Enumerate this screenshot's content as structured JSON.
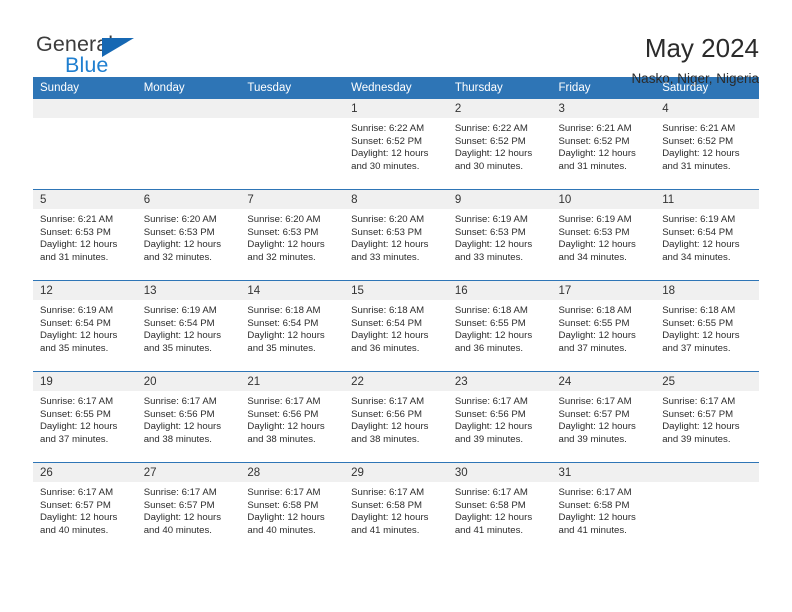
{
  "brand": {
    "word_one": "General",
    "word_two": "Blue",
    "logo_icon": "triangle-flag-icon",
    "accent_color": "#1668b3"
  },
  "header": {
    "title": "May 2024",
    "location": "Nasko, Niger, Nigeria"
  },
  "theme": {
    "header_blue": "#2e75b6",
    "daynum_band": "#f0f0f0",
    "text": "#2c2c2c"
  },
  "weekday_headers": [
    "Sunday",
    "Monday",
    "Tuesday",
    "Wednesday",
    "Thursday",
    "Friday",
    "Saturday"
  ],
  "weeks": [
    [
      {
        "day": "",
        "empty": true
      },
      {
        "day": "",
        "empty": true
      },
      {
        "day": "",
        "empty": true
      },
      {
        "day": "1",
        "sunrise": "Sunrise: 6:22 AM",
        "sunset": "Sunset: 6:52 PM",
        "daylight_1": "Daylight: 12 hours",
        "daylight_2": "and 30 minutes."
      },
      {
        "day": "2",
        "sunrise": "Sunrise: 6:22 AM",
        "sunset": "Sunset: 6:52 PM",
        "daylight_1": "Daylight: 12 hours",
        "daylight_2": "and 30 minutes."
      },
      {
        "day": "3",
        "sunrise": "Sunrise: 6:21 AM",
        "sunset": "Sunset: 6:52 PM",
        "daylight_1": "Daylight: 12 hours",
        "daylight_2": "and 31 minutes."
      },
      {
        "day": "4",
        "sunrise": "Sunrise: 6:21 AM",
        "sunset": "Sunset: 6:52 PM",
        "daylight_1": "Daylight: 12 hours",
        "daylight_2": "and 31 minutes."
      }
    ],
    [
      {
        "day": "5",
        "sunrise": "Sunrise: 6:21 AM",
        "sunset": "Sunset: 6:53 PM",
        "daylight_1": "Daylight: 12 hours",
        "daylight_2": "and 31 minutes."
      },
      {
        "day": "6",
        "sunrise": "Sunrise: 6:20 AM",
        "sunset": "Sunset: 6:53 PM",
        "daylight_1": "Daylight: 12 hours",
        "daylight_2": "and 32 minutes."
      },
      {
        "day": "7",
        "sunrise": "Sunrise: 6:20 AM",
        "sunset": "Sunset: 6:53 PM",
        "daylight_1": "Daylight: 12 hours",
        "daylight_2": "and 32 minutes."
      },
      {
        "day": "8",
        "sunrise": "Sunrise: 6:20 AM",
        "sunset": "Sunset: 6:53 PM",
        "daylight_1": "Daylight: 12 hours",
        "daylight_2": "and 33 minutes."
      },
      {
        "day": "9",
        "sunrise": "Sunrise: 6:19 AM",
        "sunset": "Sunset: 6:53 PM",
        "daylight_1": "Daylight: 12 hours",
        "daylight_2": "and 33 minutes."
      },
      {
        "day": "10",
        "sunrise": "Sunrise: 6:19 AM",
        "sunset": "Sunset: 6:53 PM",
        "daylight_1": "Daylight: 12 hours",
        "daylight_2": "and 34 minutes."
      },
      {
        "day": "11",
        "sunrise": "Sunrise: 6:19 AM",
        "sunset": "Sunset: 6:54 PM",
        "daylight_1": "Daylight: 12 hours",
        "daylight_2": "and 34 minutes."
      }
    ],
    [
      {
        "day": "12",
        "sunrise": "Sunrise: 6:19 AM",
        "sunset": "Sunset: 6:54 PM",
        "daylight_1": "Daylight: 12 hours",
        "daylight_2": "and 35 minutes."
      },
      {
        "day": "13",
        "sunrise": "Sunrise: 6:19 AM",
        "sunset": "Sunset: 6:54 PM",
        "daylight_1": "Daylight: 12 hours",
        "daylight_2": "and 35 minutes."
      },
      {
        "day": "14",
        "sunrise": "Sunrise: 6:18 AM",
        "sunset": "Sunset: 6:54 PM",
        "daylight_1": "Daylight: 12 hours",
        "daylight_2": "and 35 minutes."
      },
      {
        "day": "15",
        "sunrise": "Sunrise: 6:18 AM",
        "sunset": "Sunset: 6:54 PM",
        "daylight_1": "Daylight: 12 hours",
        "daylight_2": "and 36 minutes."
      },
      {
        "day": "16",
        "sunrise": "Sunrise: 6:18 AM",
        "sunset": "Sunset: 6:55 PM",
        "daylight_1": "Daylight: 12 hours",
        "daylight_2": "and 36 minutes."
      },
      {
        "day": "17",
        "sunrise": "Sunrise: 6:18 AM",
        "sunset": "Sunset: 6:55 PM",
        "daylight_1": "Daylight: 12 hours",
        "daylight_2": "and 37 minutes."
      },
      {
        "day": "18",
        "sunrise": "Sunrise: 6:18 AM",
        "sunset": "Sunset: 6:55 PM",
        "daylight_1": "Daylight: 12 hours",
        "daylight_2": "and 37 minutes."
      }
    ],
    [
      {
        "day": "19",
        "sunrise": "Sunrise: 6:17 AM",
        "sunset": "Sunset: 6:55 PM",
        "daylight_1": "Daylight: 12 hours",
        "daylight_2": "and 37 minutes."
      },
      {
        "day": "20",
        "sunrise": "Sunrise: 6:17 AM",
        "sunset": "Sunset: 6:56 PM",
        "daylight_1": "Daylight: 12 hours",
        "daylight_2": "and 38 minutes."
      },
      {
        "day": "21",
        "sunrise": "Sunrise: 6:17 AM",
        "sunset": "Sunset: 6:56 PM",
        "daylight_1": "Daylight: 12 hours",
        "daylight_2": "and 38 minutes."
      },
      {
        "day": "22",
        "sunrise": "Sunrise: 6:17 AM",
        "sunset": "Sunset: 6:56 PM",
        "daylight_1": "Daylight: 12 hours",
        "daylight_2": "and 38 minutes."
      },
      {
        "day": "23",
        "sunrise": "Sunrise: 6:17 AM",
        "sunset": "Sunset: 6:56 PM",
        "daylight_1": "Daylight: 12 hours",
        "daylight_2": "and 39 minutes."
      },
      {
        "day": "24",
        "sunrise": "Sunrise: 6:17 AM",
        "sunset": "Sunset: 6:57 PM",
        "daylight_1": "Daylight: 12 hours",
        "daylight_2": "and 39 minutes."
      },
      {
        "day": "25",
        "sunrise": "Sunrise: 6:17 AM",
        "sunset": "Sunset: 6:57 PM",
        "daylight_1": "Daylight: 12 hours",
        "daylight_2": "and 39 minutes."
      }
    ],
    [
      {
        "day": "26",
        "sunrise": "Sunrise: 6:17 AM",
        "sunset": "Sunset: 6:57 PM",
        "daylight_1": "Daylight: 12 hours",
        "daylight_2": "and 40 minutes."
      },
      {
        "day": "27",
        "sunrise": "Sunrise: 6:17 AM",
        "sunset": "Sunset: 6:57 PM",
        "daylight_1": "Daylight: 12 hours",
        "daylight_2": "and 40 minutes."
      },
      {
        "day": "28",
        "sunrise": "Sunrise: 6:17 AM",
        "sunset": "Sunset: 6:58 PM",
        "daylight_1": "Daylight: 12 hours",
        "daylight_2": "and 40 minutes."
      },
      {
        "day": "29",
        "sunrise": "Sunrise: 6:17 AM",
        "sunset": "Sunset: 6:58 PM",
        "daylight_1": "Daylight: 12 hours",
        "daylight_2": "and 41 minutes."
      },
      {
        "day": "30",
        "sunrise": "Sunrise: 6:17 AM",
        "sunset": "Sunset: 6:58 PM",
        "daylight_1": "Daylight: 12 hours",
        "daylight_2": "and 41 minutes."
      },
      {
        "day": "31",
        "sunrise": "Sunrise: 6:17 AM",
        "sunset": "Sunset: 6:58 PM",
        "daylight_1": "Daylight: 12 hours",
        "daylight_2": "and 41 minutes."
      },
      {
        "day": "",
        "empty": true
      }
    ]
  ]
}
